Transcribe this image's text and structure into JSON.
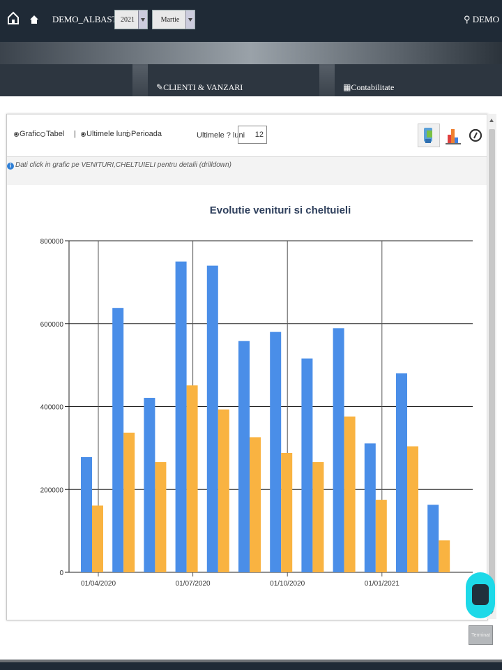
{
  "topbar": {
    "company": "DEMO_ALBASTRU",
    "year_select": "2021",
    "month_select": "Martie",
    "user": "DEMO"
  },
  "nav": {
    "tabs": [
      {
        "label": ""
      },
      {
        "label": "CLIENTI & VANZARI"
      },
      {
        "label": "Contabilitate"
      }
    ]
  },
  "toolbar": {
    "view_options": [
      "Grafic",
      "Tabel"
    ],
    "view_selected": "Grafic",
    "separator": "|",
    "period_options": [
      "Ultimele luni",
      "Perioada"
    ],
    "period_selected": "Ultimele luni",
    "months_label": "Ultimele ? luni",
    "months_value": "12",
    "info_text": "Dati click in grafic pe VENITURI,CHELTUIELI pentru detalii (drilldown)"
  },
  "colors": {
    "venituri": "#4a8ee8",
    "cheltuieli": "#f9b341"
  },
  "chart_data": {
    "type": "bar",
    "title": "Evolutie venituri si cheltuieli",
    "categories": [
      "04/2020",
      "05/2020",
      "06/2020",
      "07/2020",
      "08/2020",
      "09/2020",
      "10/2020",
      "11/2020",
      "12/2020",
      "01/2021",
      "02/2021",
      "03/2021"
    ],
    "series": [
      {
        "values": [
          278000,
          638000,
          421000,
          750000,
          740000,
          558000,
          580000,
          516000,
          589000,
          311000,
          480000,
          163000
        ]
      },
      {
        "values": [
          161000,
          337000,
          266000,
          451000,
          393000,
          326000,
          288000,
          266000,
          376000,
          175000,
          304000,
          77000
        ]
      }
    ],
    "ylim": [
      0,
      800000
    ],
    "yticks": [
      "0",
      "200000",
      "400000",
      "600000",
      "800000"
    ],
    "xtick_labels": [
      "01/04/2020",
      "01/07/2020",
      "01/10/2020",
      "01/01/2021"
    ],
    "xtick_category_index": [
      0,
      3,
      6,
      9
    ],
    "grid": true,
    "legend": "right"
  },
  "footer": {
    "finish_button": "Terminat"
  }
}
